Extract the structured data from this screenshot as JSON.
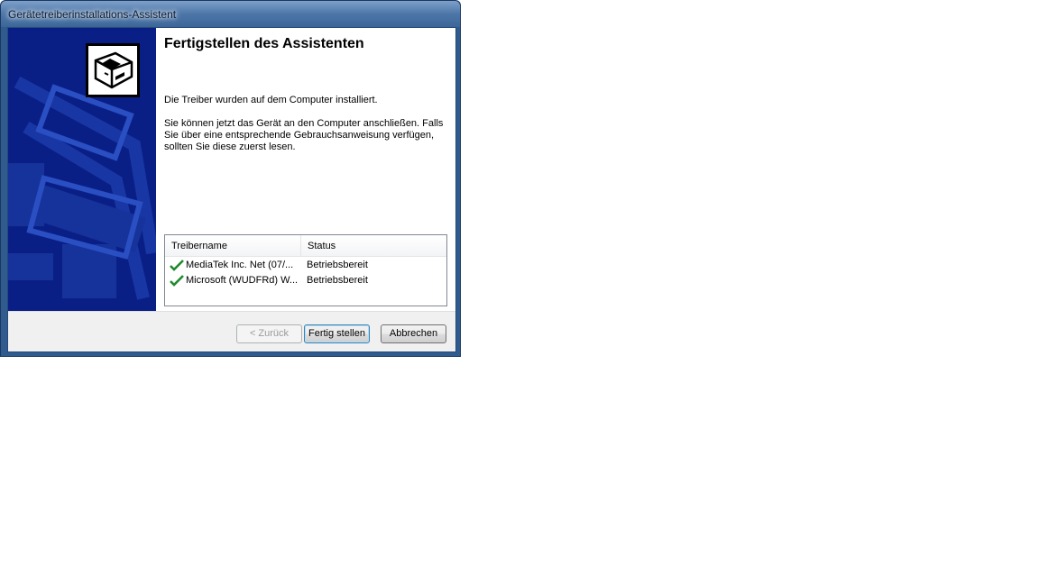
{
  "window": {
    "title": "Gerätetreiberinstallations-Assistent"
  },
  "wizard": {
    "icon": "hardware-drive-icon",
    "heading": "Fertigstellen des Assistenten",
    "paragraph1": "Die Treiber wurden auf dem Computer installiert.",
    "paragraph2": "Sie können jetzt das Gerät an den Computer anschließen. Falls Sie über eine entsprechende Gebrauchsanweisung verfügen, sollten Sie diese zuerst lesen."
  },
  "drivers_table": {
    "columns": [
      "Treibername",
      "Status"
    ],
    "rows": [
      {
        "name": "MediaTek Inc. Net  (07/...",
        "status": "Betriebsbereit",
        "icon": "green-check-icon"
      },
      {
        "name": "Microsoft (WUDFRd) W...",
        "status": "Betriebsbereit",
        "icon": "green-check-icon"
      }
    ]
  },
  "buttons": {
    "back": "< Zurück",
    "finish": "Fertig stellen",
    "cancel": "Abbrechen"
  },
  "colors": {
    "side_panel": "#0a1f86",
    "check": "#1f8a2e"
  }
}
